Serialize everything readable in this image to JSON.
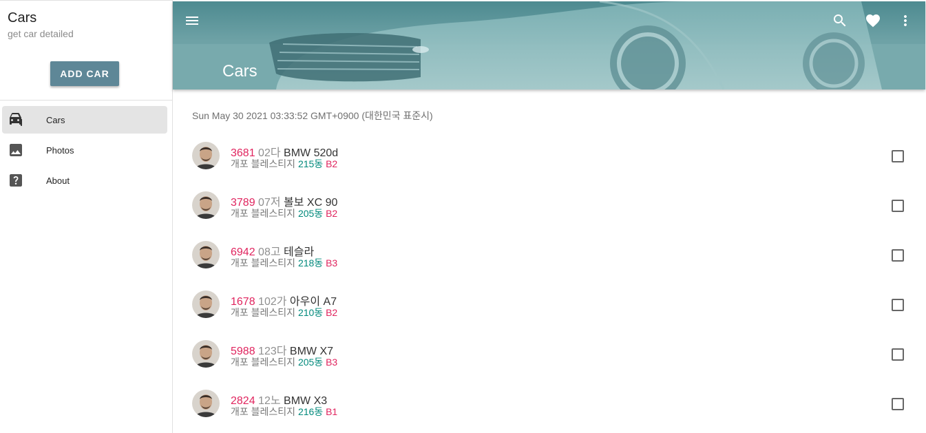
{
  "sidebar": {
    "title": "Cars",
    "subtitle": "get car detailed",
    "add_button": "ADD CAR",
    "items": [
      {
        "label": "Cars",
        "icon": "car-icon",
        "active": true
      },
      {
        "label": "Photos",
        "icon": "photo-icon",
        "active": false
      },
      {
        "label": "About",
        "icon": "help-icon",
        "active": false
      }
    ]
  },
  "header": {
    "title": "Cars",
    "icons": [
      "menu-icon",
      "search-icon",
      "heart-icon",
      "more-vert-icon"
    ]
  },
  "main": {
    "date": "Sun May 30 2021 03:33:52 GMT+0900 (대한민국 표준시)",
    "cars": [
      {
        "num": "3681",
        "prefix": "02다",
        "model": "BMW 520d",
        "apt": "개포 블레스티지",
        "dong": "215동",
        "parking": "B2",
        "checked": false
      },
      {
        "num": "3789",
        "prefix": "07저",
        "model": "볼보 XC 90",
        "apt": "개포 블레스티지",
        "dong": "205동",
        "parking": "B2",
        "checked": false
      },
      {
        "num": "6942",
        "prefix": "08고",
        "model": "테슬라",
        "apt": "개포 블레스티지",
        "dong": "218동",
        "parking": "B3",
        "checked": false
      },
      {
        "num": "1678",
        "prefix": "102가",
        "model": "아우이 A7",
        "apt": "개포 블레스티지",
        "dong": "210동",
        "parking": "B2",
        "checked": false
      },
      {
        "num": "5988",
        "prefix": "123다",
        "model": "BMW X7",
        "apt": "개포 블레스티지",
        "dong": "205동",
        "parking": "B3",
        "checked": false
      },
      {
        "num": "2824",
        "prefix": "12노",
        "model": "BMW X3",
        "apt": "개포 블레스티지",
        "dong": "216동",
        "parking": "B1",
        "checked": false
      }
    ]
  },
  "colors": {
    "accent": "#5e8797",
    "plate_number": "#e0245e",
    "dong": "#00897b",
    "header": "#6ea2a6"
  }
}
